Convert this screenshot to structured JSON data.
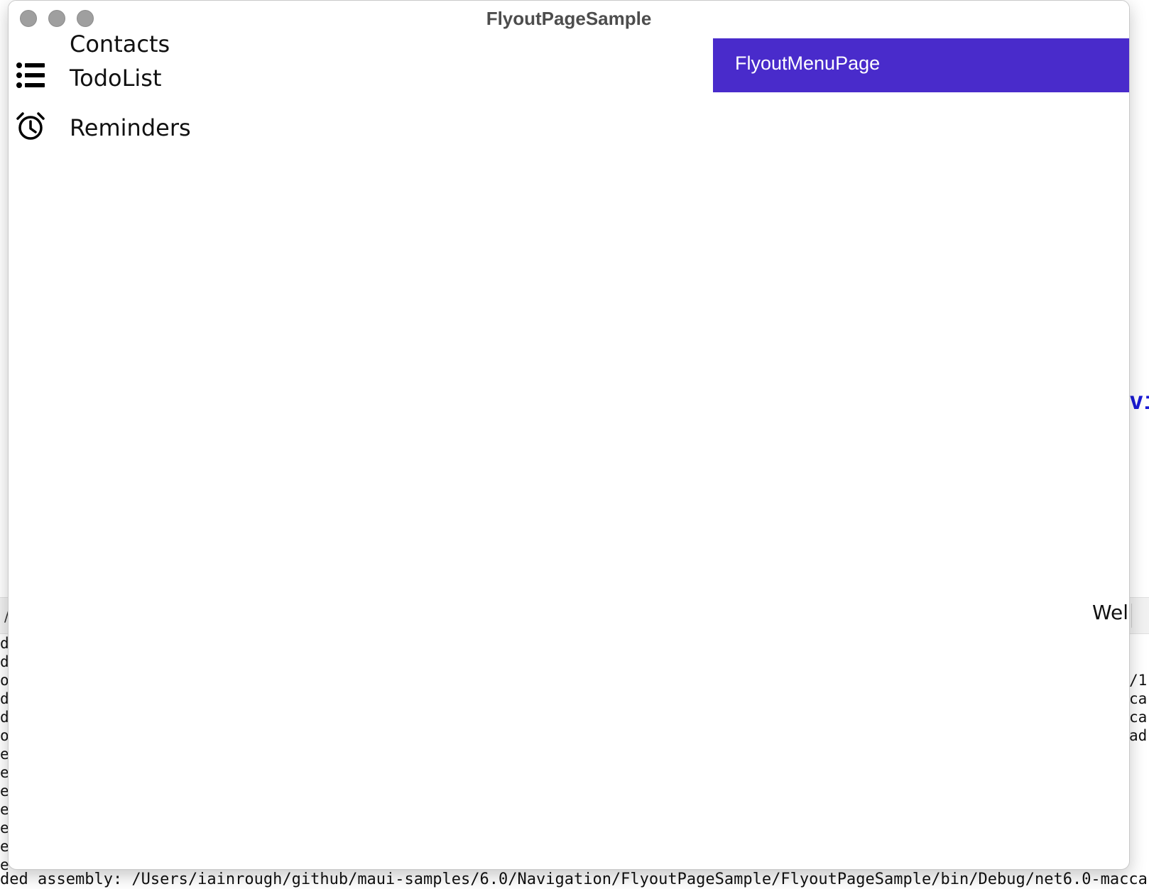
{
  "window": {
    "title": "FlyoutPageSample"
  },
  "flyout_menu": {
    "header_label": "FlyoutMenuPage",
    "header_color": "#492bcb",
    "items": [
      {
        "label": "Contacts",
        "icon": "contacts-icon"
      },
      {
        "label": "TodoList",
        "icon": "list-bullet-icon"
      },
      {
        "label": "Reminders",
        "icon": "alarm-clock-icon"
      }
    ]
  },
  "detail": {
    "welcome_fragment": "Welc"
  },
  "background_console": {
    "left_column_chars": [
      "d",
      "d",
      "o",
      "d",
      "d",
      "o",
      "e",
      "e",
      "e",
      "e",
      "e",
      "e",
      "e"
    ],
    "right_column_chars": [
      "/1",
      "ca",
      "ca",
      "ad"
    ],
    "blue_code_fragment": "vi",
    "bottom_line": "ded assembly: /Users/iainrough/github/maui-samples/6.0/Navigation/FlyoutPageSample/FlyoutPageSample/bin/Debug/net6.0-macca"
  }
}
